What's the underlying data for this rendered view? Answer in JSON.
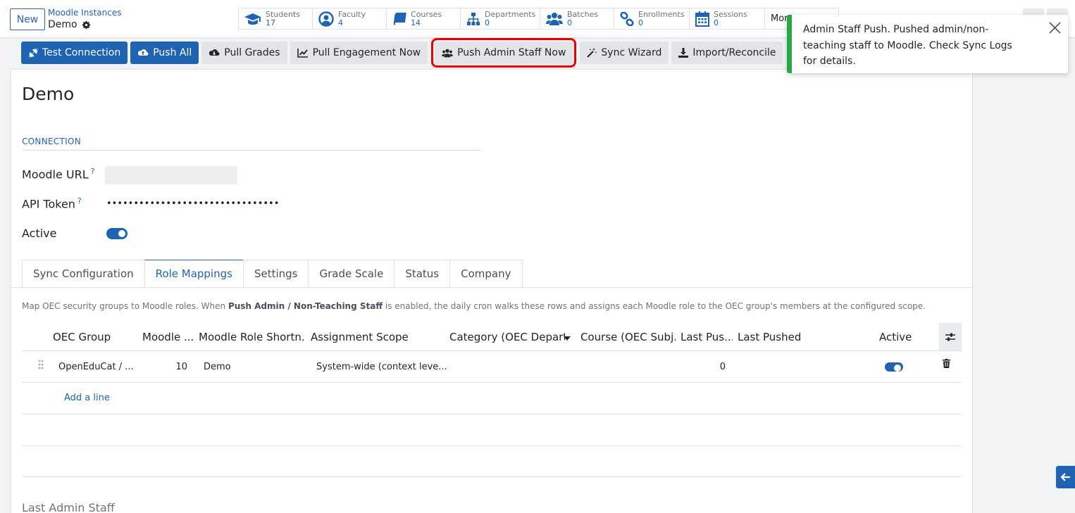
{
  "header": {
    "new_label": "New",
    "breadcrumb": "Moodle Instances",
    "record_name": "Demo",
    "more_label": "More"
  },
  "stats": [
    {
      "label": "Students",
      "value": "17",
      "icon": "graduation-cap-icon"
    },
    {
      "label": "Faculty",
      "value": "4",
      "icon": "user-circle-icon"
    },
    {
      "label": "Courses",
      "value": "14",
      "icon": "book-icon"
    },
    {
      "label": "Departments",
      "value": "0",
      "icon": "sitemap-icon"
    },
    {
      "label": "Batches",
      "value": "0",
      "icon": "users-icon"
    },
    {
      "label": "Enrollments",
      "value": "0",
      "icon": "link-icon"
    },
    {
      "label": "Sessions",
      "value": "0",
      "icon": "calendar-icon"
    }
  ],
  "actions": {
    "test_connection": "Test Connection",
    "push_all": "Push All",
    "pull_grades": "Pull Grades",
    "pull_engagement": "Pull Engagement Now",
    "push_admin_staff": "Push Admin Staff Now",
    "sync_wizard": "Sync Wizard",
    "import_reconcile": "Import/Reconcile"
  },
  "form": {
    "title": "Demo",
    "section_connection": "CONNECTION",
    "moodle_url_label": "Moodle URL",
    "api_token_label": "API Token",
    "api_token_value": "••••••••••••••••••••••••••••••••",
    "active_label": "Active",
    "help_mark": "?"
  },
  "tabs": [
    "Sync Configuration",
    "Role Mappings",
    "Settings",
    "Grade Scale",
    "Status",
    "Company"
  ],
  "role_mappings": {
    "help_pre": "Map OEC security groups to Moodle roles. When ",
    "help_bold": "Push Admin / Non-Teaching Staff",
    "help_post": " is enabled, the daily cron walks these rows and assigns each Moodle role to the OEC group's members at the configured scope.",
    "columns": [
      "OEC Group",
      "Moodle ...",
      "Moodle Role Shortn...",
      "Assignment Scope",
      "Category (OEC Depart...",
      "Course (OEC Subj...",
      "Last Pus...",
      "Last Pushed",
      "Active"
    ],
    "rows": [
      {
        "oec_group": "OpenEduCat / ...",
        "moodle_id": "10",
        "shortname": "Demo",
        "scope": "System-wide (context leve...",
        "category": "",
        "course": "",
        "last_push_count": "0",
        "last_pushed": ""
      }
    ],
    "add_line": "Add a line"
  },
  "footer_section": "Last Admin Staff",
  "toast": {
    "message": "Admin Staff Push. Pushed admin/non-teaching staff to Moodle. Check Sync Logs for details.",
    "accent": "#28a745"
  },
  "colors": {
    "primary": "#1f64b3",
    "highlight": "#e00000"
  }
}
